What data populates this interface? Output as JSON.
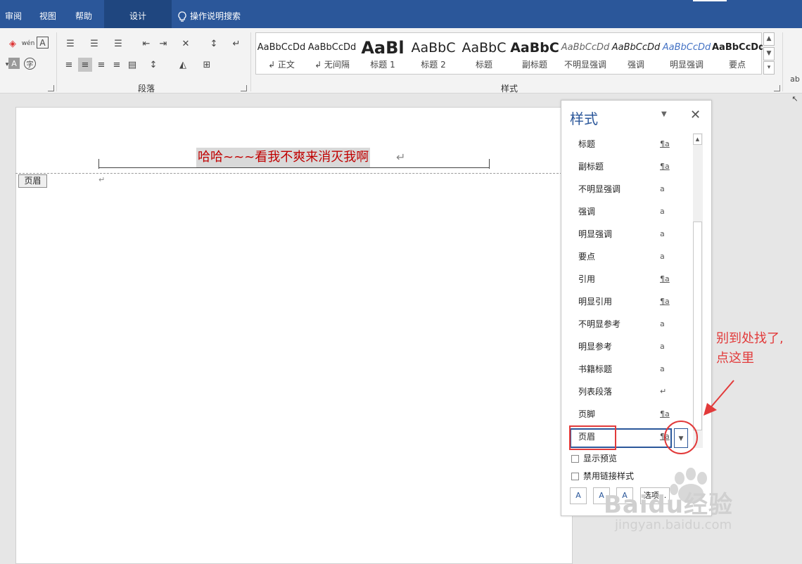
{
  "tabs": {
    "review": "审阅",
    "view": "视图",
    "help": "帮助",
    "design": "设计",
    "search": "操作说明搜索"
  },
  "ribbon": {
    "paragraph_label": "段落",
    "styles_label": "样式"
  },
  "gallery": [
    {
      "preview": "AaBbCcDd",
      "name": "↲ 正文"
    },
    {
      "preview": "AaBbCcDd",
      "name": "↲ 无间隔"
    },
    {
      "preview": "AaBl",
      "name": "标题 1"
    },
    {
      "preview": "AaBbC",
      "name": "标题 2"
    },
    {
      "preview": "AaBbC",
      "name": "标题"
    },
    {
      "preview": "AaBbC",
      "name": "副标题"
    },
    {
      "preview": "AaBbCcDd",
      "name": "不明显强调"
    },
    {
      "preview": "AaBbCcDd",
      "name": "强调"
    },
    {
      "preview": "AaBbCcDd",
      "name": "明显强调"
    },
    {
      "preview": "AaBbCcDd",
      "name": "要点"
    }
  ],
  "document": {
    "header_text": "哈哈~~~看我不爽来消灭我啊",
    "para_mark": "↵",
    "header_tag": "页眉"
  },
  "pane": {
    "title": "样式",
    "close": "✕",
    "menu": "▼",
    "styles": [
      {
        "name": "标题",
        "icon": "¶a"
      },
      {
        "name": "副标题",
        "icon": "¶a"
      },
      {
        "name": "不明显强调",
        "icon": "a"
      },
      {
        "name": "强调",
        "icon": "a"
      },
      {
        "name": "明显强调",
        "icon": "a"
      },
      {
        "name": "要点",
        "icon": "a"
      },
      {
        "name": "引用",
        "icon": "¶a"
      },
      {
        "name": "明显引用",
        "icon": "¶a"
      },
      {
        "name": "不明显参考",
        "icon": "a"
      },
      {
        "name": "明显参考",
        "icon": "a"
      },
      {
        "name": "书籍标题",
        "icon": "a"
      },
      {
        "name": "列表段落",
        "icon": "↵"
      },
      {
        "name": "页脚",
        "icon": "¶a"
      },
      {
        "name": "页眉",
        "icon": "¶a"
      }
    ],
    "show_preview": "显示预览",
    "disable_linked": "禁用链接样式",
    "options": "选项..."
  },
  "annotation": {
    "line1": "别到处找了,",
    "line2": "点这里"
  },
  "watermark": {
    "brand": "Baidu经验",
    "url": "jingyan.baidu.com"
  },
  "colors": {
    "accent": "#2b579a",
    "annotation": "#e23a3a",
    "header_text": "#c00000"
  }
}
